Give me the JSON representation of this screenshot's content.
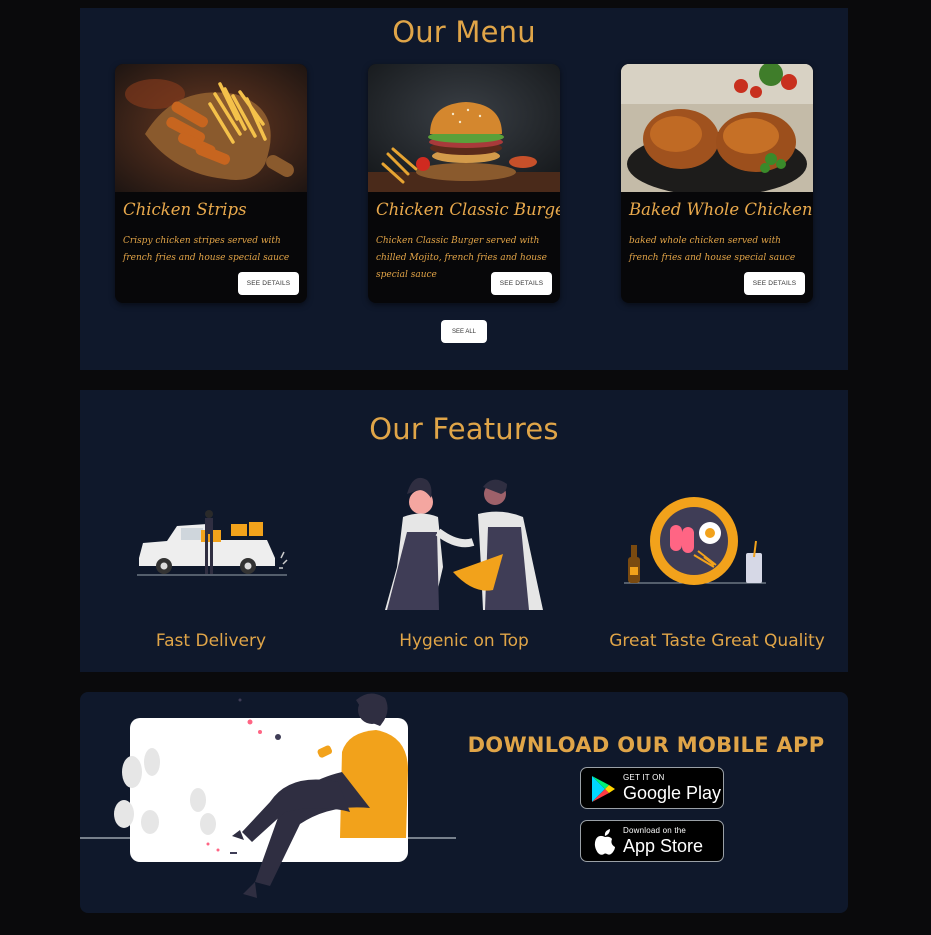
{
  "menu": {
    "title": "Our Menu",
    "items": [
      {
        "name": "Chicken Strips",
        "description": "Crispy chicken stripes served with french fries and house special sauce",
        "button": "SEE DETAILS",
        "image": "chicken-strips-photo"
      },
      {
        "name": "Chicken Classic Burger",
        "description": "Chicken Classic Burger served with chilled Mojito, french fries and house special sauce",
        "button": "SEE DETAILS",
        "image": "burger-photo"
      },
      {
        "name": "Baked Whole Chicken",
        "description": "baked whole chicken served with french fries and house special sauce",
        "button": "SEE DETAILS",
        "image": "baked-chicken-photo"
      }
    ],
    "see_all": "SEE ALL"
  },
  "features": {
    "title": "Our Features",
    "items": [
      {
        "label": "Fast Delivery",
        "icon": "delivery-truck-illustration"
      },
      {
        "label": "Hygenic on Top",
        "icon": "chefs-illustration"
      },
      {
        "label": "Great Taste Great Quality",
        "icon": "food-plate-illustration"
      }
    ]
  },
  "download": {
    "title": "DOWNLOAD OUR MOBILE APP",
    "google_play": {
      "small": "GET IT ON",
      "big": "Google Play"
    },
    "app_store": {
      "small": "Download on the",
      "big": "App Store"
    }
  },
  "colors": {
    "accent": "#e0a548",
    "section_bg": "#0f182b",
    "page_bg": "#0a0a0c"
  }
}
